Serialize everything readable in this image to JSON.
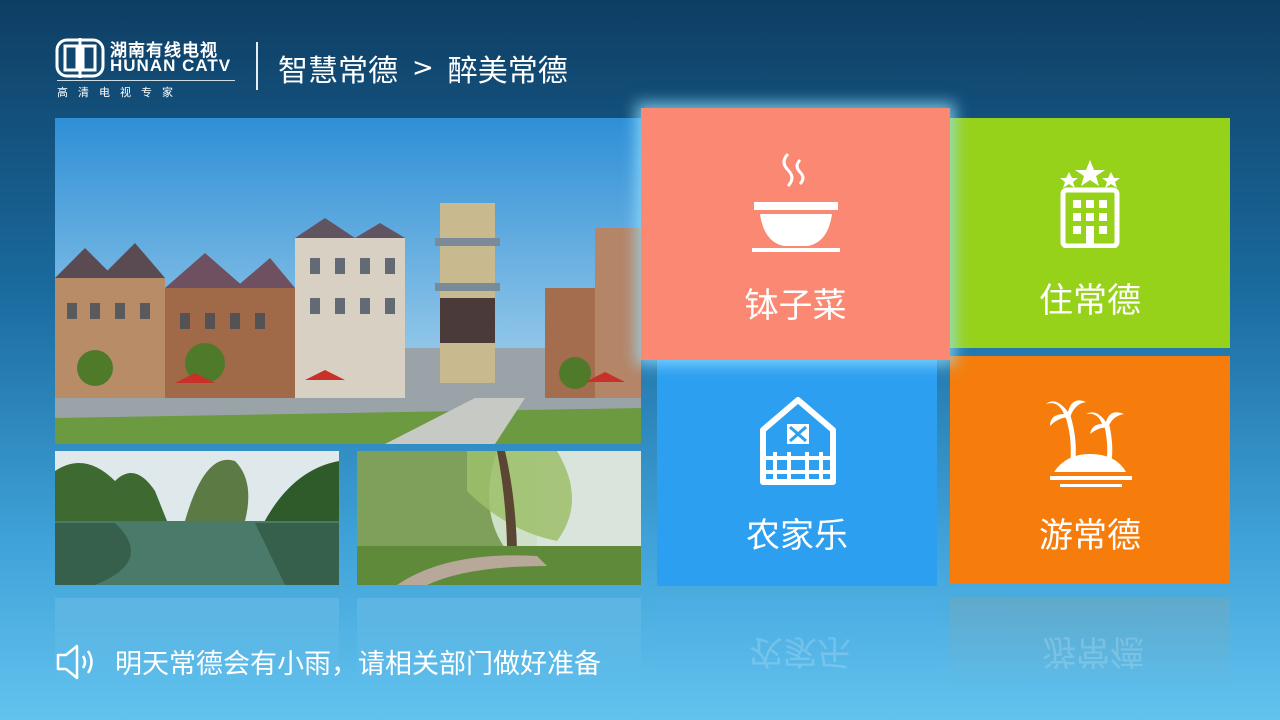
{
  "brand": {
    "name_cn": "湖南有线电视",
    "name_en": "HUNAN CATV",
    "tagline": "高清电视专家"
  },
  "breadcrumb": {
    "parent": "智慧常德",
    "separator": ">",
    "current": "醉美常德"
  },
  "tiles": [
    {
      "label": "钵子菜",
      "color": "#fa8872",
      "icon": "soup-bowl-icon",
      "focused": true
    },
    {
      "label": "住常德",
      "color": "#97d21b",
      "icon": "hotel-icon"
    },
    {
      "label": "农家乐",
      "color": "#2c9ff1",
      "icon": "farmhouse-icon"
    },
    {
      "label": "游常德",
      "color": "#f67d0b",
      "icon": "palm-island-icon"
    }
  ],
  "photos": [
    {
      "subject": "european-style-town-street"
    },
    {
      "subject": "river-with-karst-mountains"
    },
    {
      "subject": "willow-tree-park"
    }
  ],
  "notice": {
    "icon": "speaker-icon",
    "text": "明天常德会有小雨，请相关部门做好准备"
  }
}
